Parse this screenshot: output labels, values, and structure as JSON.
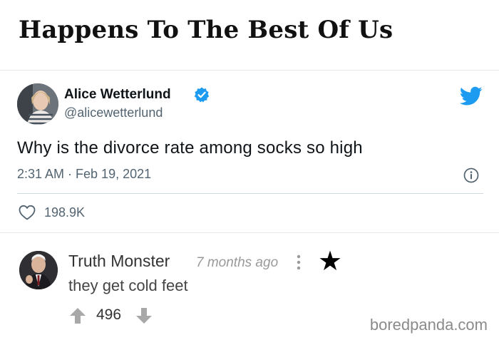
{
  "header": {
    "title": "Happens To The Best Of Us"
  },
  "tweet": {
    "author_name": "Alice Wetterlund",
    "handle": "@alicewetterlund",
    "text": "Why is the divorce rate among socks so high",
    "timestamp": "2:31 AM · Feb 19, 2021",
    "likes": "198.9K",
    "accent_color": "#1d9bf0",
    "icons": [
      "verified-badge-icon",
      "twitter-bird-icon",
      "info-icon",
      "heart-icon"
    ]
  },
  "comment": {
    "author": "Truth Monster",
    "time": "7 months ago",
    "text": "they get cold feet",
    "votes": "496",
    "star_glyph": "★",
    "icons": [
      "more-options-icon",
      "star-icon",
      "upvote-arrow-icon",
      "downvote-arrow-icon"
    ]
  },
  "footer": {
    "watermark": "boredpanda.com"
  }
}
